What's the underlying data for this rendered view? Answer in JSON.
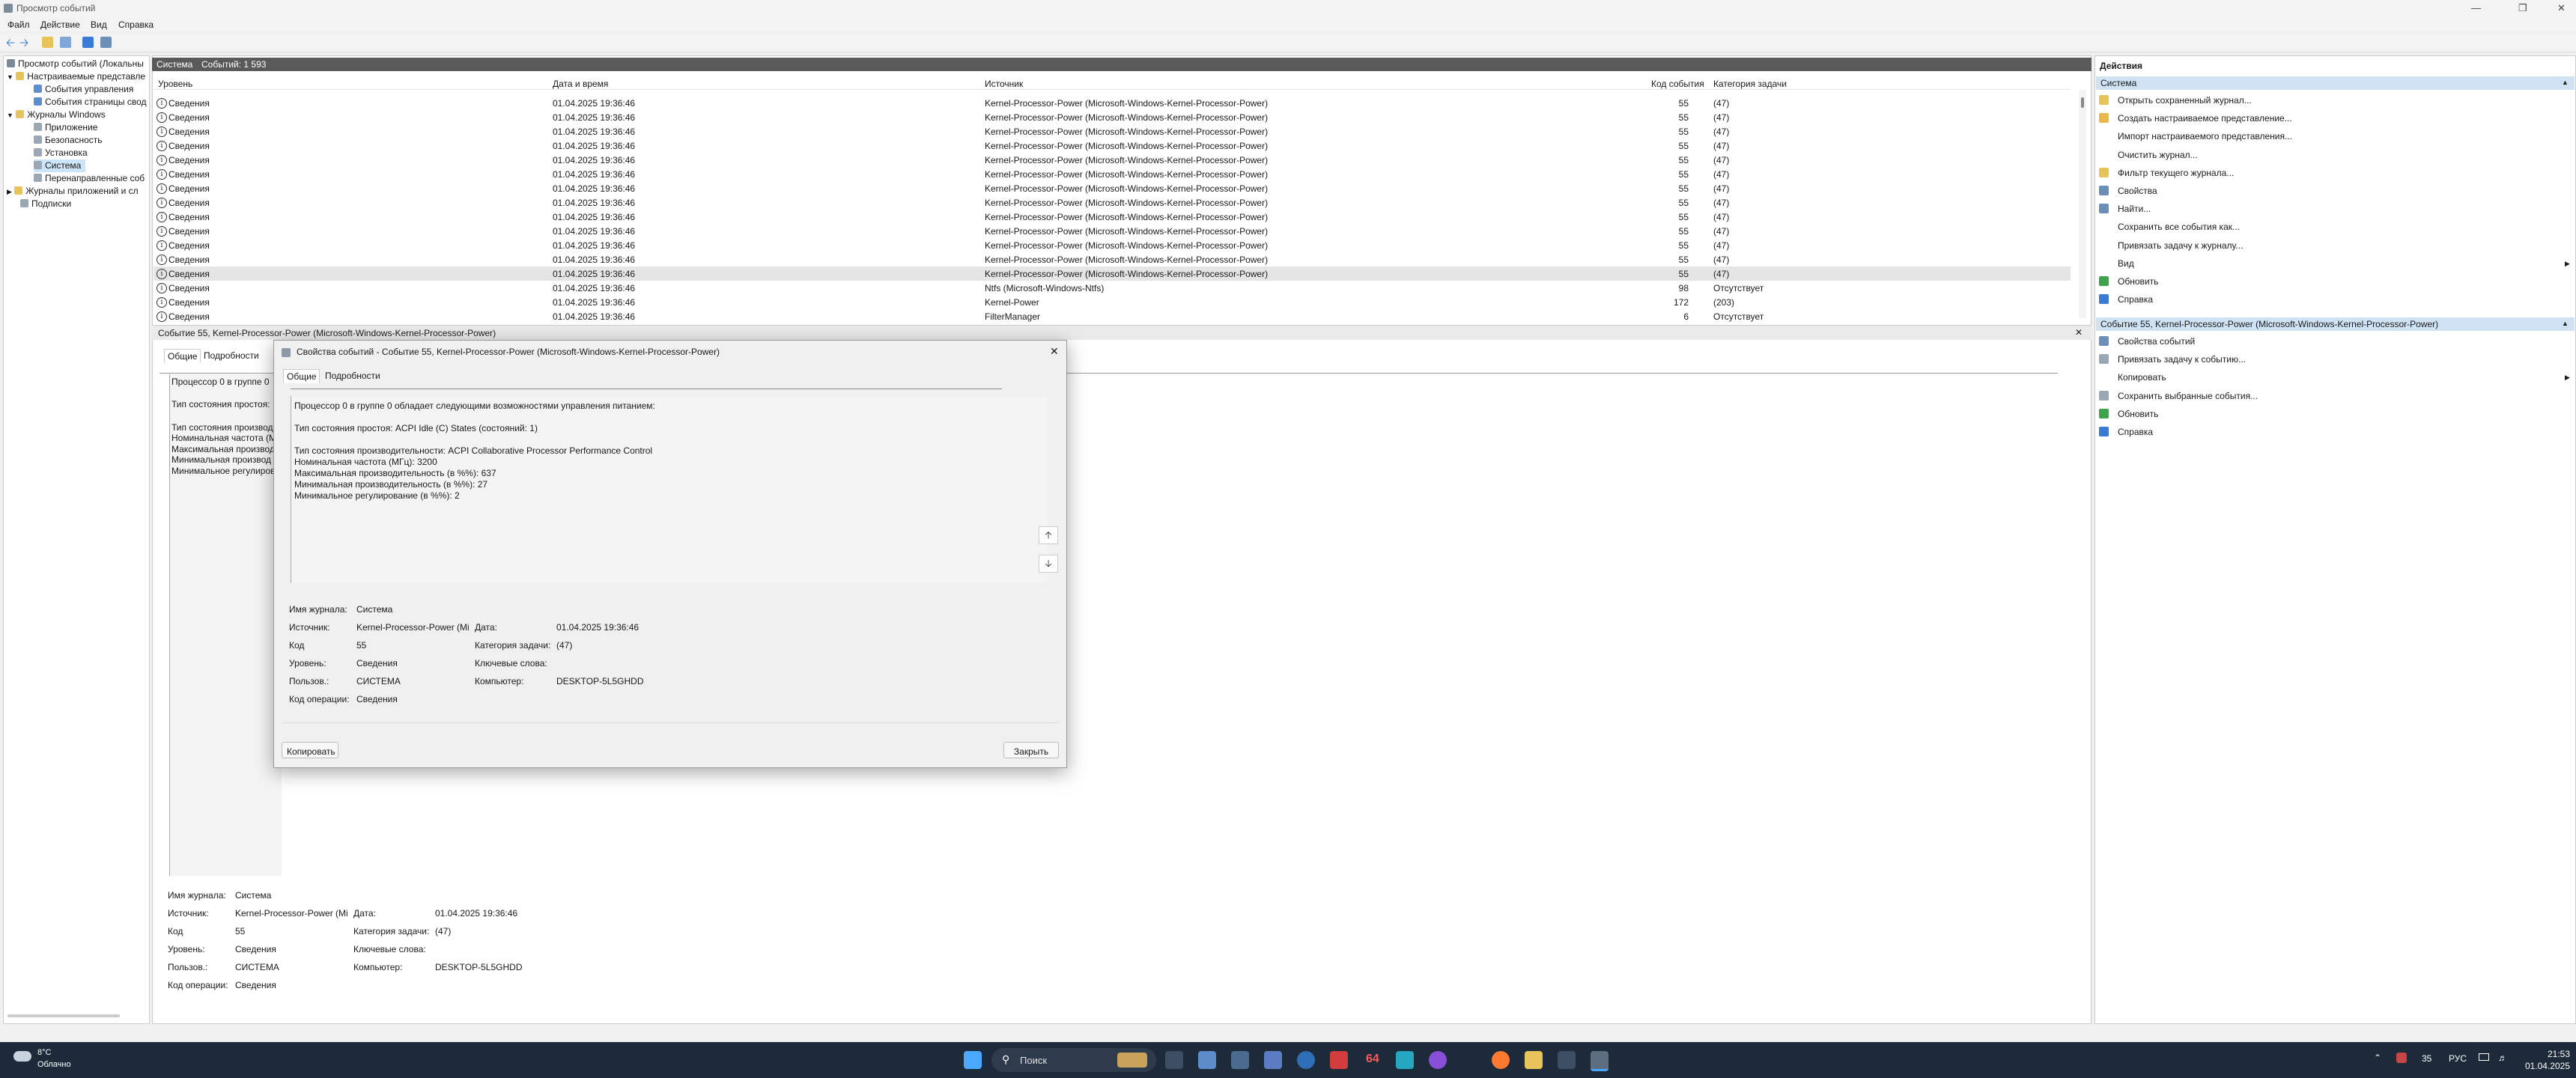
{
  "window": {
    "title": "Просмотр событий"
  },
  "menu": [
    "Файл",
    "Действие",
    "Вид",
    "Справка"
  ],
  "tree": [
    {
      "label": "Просмотр событий (Локальны",
      "indent": 0
    },
    {
      "label": "Настраиваемые представле",
      "indent": 1
    },
    {
      "label": "События управления",
      "indent": 2
    },
    {
      "label": "События страницы свод",
      "indent": 2
    },
    {
      "label": "Журналы Windows",
      "indent": 1
    },
    {
      "label": "Приложение",
      "indent": 2
    },
    {
      "label": "Безопасность",
      "indent": 2
    },
    {
      "label": "Установка",
      "indent": 2
    },
    {
      "label": "Система",
      "indent": 2,
      "selected": true
    },
    {
      "label": "Перенаправленные соб",
      "indent": 2
    },
    {
      "label": "Журналы приложений и сл",
      "indent": 1
    },
    {
      "label": "Подписки",
      "indent": 1
    }
  ],
  "list": {
    "name": "Система",
    "count": "Событий: 1 593",
    "columns": {
      "level": "Уровень",
      "date": "Дата и время",
      "source": "Источник",
      "code": "Код события",
      "category": "Категория задачи"
    },
    "rows": [
      {
        "level": "Сведения",
        "date": "01.04.2025 19:36:46",
        "source": "Kernel-Processor-Power (Microsoft-Windows-Kernel-Processor-Power)",
        "code": "55",
        "category": "(47)"
      },
      {
        "level": "Сведения",
        "date": "01.04.2025 19:36:46",
        "source": "Kernel-Processor-Power (Microsoft-Windows-Kernel-Processor-Power)",
        "code": "55",
        "category": "(47)"
      },
      {
        "level": "Сведения",
        "date": "01.04.2025 19:36:46",
        "source": "Kernel-Processor-Power (Microsoft-Windows-Kernel-Processor-Power)",
        "code": "55",
        "category": "(47)"
      },
      {
        "level": "Сведения",
        "date": "01.04.2025 19:36:46",
        "source": "Kernel-Processor-Power (Microsoft-Windows-Kernel-Processor-Power)",
        "code": "55",
        "category": "(47)"
      },
      {
        "level": "Сведения",
        "date": "01.04.2025 19:36:46",
        "source": "Kernel-Processor-Power (Microsoft-Windows-Kernel-Processor-Power)",
        "code": "55",
        "category": "(47)"
      },
      {
        "level": "Сведения",
        "date": "01.04.2025 19:36:46",
        "source": "Kernel-Processor-Power (Microsoft-Windows-Kernel-Processor-Power)",
        "code": "55",
        "category": "(47)"
      },
      {
        "level": "Сведения",
        "date": "01.04.2025 19:36:46",
        "source": "Kernel-Processor-Power (Microsoft-Windows-Kernel-Processor-Power)",
        "code": "55",
        "category": "(47)"
      },
      {
        "level": "Сведения",
        "date": "01.04.2025 19:36:46",
        "source": "Kernel-Processor-Power (Microsoft-Windows-Kernel-Processor-Power)",
        "code": "55",
        "category": "(47)"
      },
      {
        "level": "Сведения",
        "date": "01.04.2025 19:36:46",
        "source": "Kernel-Processor-Power (Microsoft-Windows-Kernel-Processor-Power)",
        "code": "55",
        "category": "(47)"
      },
      {
        "level": "Сведения",
        "date": "01.04.2025 19:36:46",
        "source": "Kernel-Processor-Power (Microsoft-Windows-Kernel-Processor-Power)",
        "code": "55",
        "category": "(47)"
      },
      {
        "level": "Сведения",
        "date": "01.04.2025 19:36:46",
        "source": "Kernel-Processor-Power (Microsoft-Windows-Kernel-Processor-Power)",
        "code": "55",
        "category": "(47)"
      },
      {
        "level": "Сведения",
        "date": "01.04.2025 19:36:46",
        "source": "Kernel-Processor-Power (Microsoft-Windows-Kernel-Processor-Power)",
        "code": "55",
        "category": "(47)"
      },
      {
        "level": "Сведения",
        "date": "01.04.2025 19:36:46",
        "source": "Kernel-Processor-Power (Microsoft-Windows-Kernel-Processor-Power)",
        "code": "55",
        "category": "(47)",
        "selected": true
      },
      {
        "level": "Сведения",
        "date": "01.04.2025 19:36:46",
        "source": "Ntfs (Microsoft-Windows-Ntfs)",
        "code": "98",
        "category": "Отсутствует"
      },
      {
        "level": "Сведения",
        "date": "01.04.2025 19:36:46",
        "source": "Kernel-Power",
        "code": "172",
        "category": "(203)"
      },
      {
        "level": "Сведения",
        "date": "01.04.2025 19:36:46",
        "source": "FilterManager",
        "code": "6",
        "category": "Отсутствует"
      }
    ]
  },
  "preview": {
    "header": "Событие 55, Kernel-Processor-Power (Microsoft-Windows-Kernel-Processor-Power)",
    "tabs": [
      "Общие",
      "Подробности"
    ],
    "text_lines": [
      "Процессор 0 в группе 0",
      "Тип состояния простоя: ",
      "Тип состояния производ",
      "Номинальная частота (М",
      "Максимальная производ",
      "Минимальная производ",
      "Минимальное регулиров"
    ],
    "fields": {
      "log_name_label": "Имя журнала:",
      "log_name": "Система",
      "source_label": "Источник:",
      "source": "Kernel-Processor-Power (Mi",
      "date_label": "Дата:",
      "date": "01.04.2025 19:36:46",
      "code_label": "Код",
      "code": "55",
      "category_label": "Категория задачи:",
      "category": "(47)",
      "level_label": "Уровень:",
      "level": "Сведения",
      "keywords_label": "Ключевые слова:",
      "user_label": "Пользов.:",
      "user": "СИСТЕМА",
      "computer_label": "Компьютер:",
      "computer": "DESKTOP-5L5GHDD",
      "opcode_label": "Код операции:",
      "opcode": "Сведения"
    }
  },
  "actions": {
    "title": "Действия",
    "system_header": "Система",
    "system_items": [
      "Открыть сохраненный журнал...",
      "Создать настраиваемое представление...",
      "Импорт настраиваемого представления...",
      "Очистить журнал...",
      "Фильтр текущего журнала...",
      "Свойства",
      "Найти...",
      "Сохранить все события как...",
      "Привязать задачу к журналу...",
      "Вид",
      "Обновить",
      "Справка"
    ],
    "event_header": "Событие 55, Kernel-Processor-Power (Microsoft-Windows-Kernel-Processor-Power)",
    "event_items": [
      "Свойства событий",
      "Привязать задачу к событию...",
      "Копировать",
      "Сохранить выбранные события...",
      "Обновить",
      "Справка"
    ]
  },
  "dialog": {
    "title": "Свойства событий - Событие 55, Kernel-Processor-Power (Microsoft-Windows-Kernel-Processor-Power)",
    "tabs": [
      "Общие",
      "Подробности"
    ],
    "text_lines": [
      "Процессор 0 в группе 0 обладает следующими возможностями управления питанием:",
      "",
      "Тип состояния простоя: ACPI Idle (C) States (состояний: 1)",
      "",
      "Тип состояния производительности: ACPI Collaborative Processor Performance Control",
      "Номинальная частота (МГц): 3200",
      "Максимальная производительность (в %%): 637",
      "Минимальная производительность (в %%): 27",
      "Минимальное регулирование (в %%): 2"
    ],
    "fields": {
      "log_name_label": "Имя журнала:",
      "log_name": "Система",
      "source_label": "Источник:",
      "source": "Kernel-Processor-Power (Mi",
      "date_label": "Дата:",
      "date": "01.04.2025 19:36:46",
      "code_label": "Код",
      "code": "55",
      "category_label": "Категория задачи:",
      "category": "(47)",
      "level_label": "Уровень:",
      "level": "Сведения",
      "keywords_label": "Ключевые слова:",
      "user_label": "Пользов.:",
      "user": "СИСТЕМА",
      "computer_label": "Компьютер:",
      "computer": "DESKTOP-5L5GHDD",
      "opcode_label": "Код операции:",
      "opcode": "Сведения"
    },
    "copy_button": "Копировать",
    "close_button": "Закрыть"
  },
  "taskbar": {
    "weather_temp": "8°C",
    "weather_desc": "Облачно",
    "search_placeholder": "Поиск",
    "badge": "64",
    "tray_num": "35",
    "lang": "РУС",
    "time": "21:53",
    "date": "01.04.2025"
  },
  "colors": {
    "accent": "#0067c0",
    "list_header": "#5a5a5a",
    "selection": "#cce4f7",
    "taskbar": "#1c2a3a"
  }
}
